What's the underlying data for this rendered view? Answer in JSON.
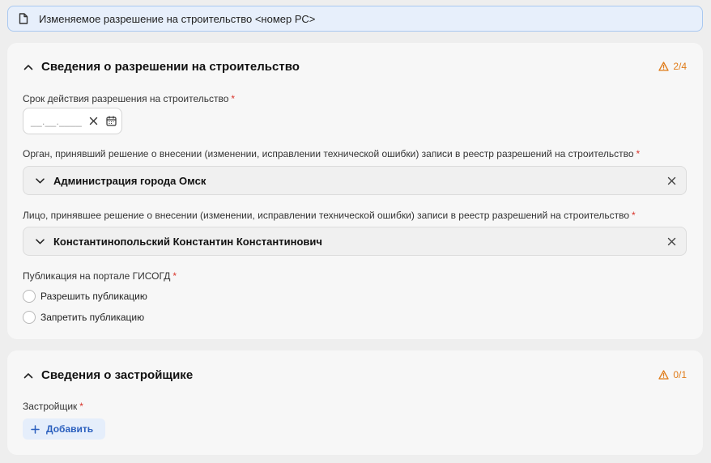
{
  "header": {
    "title": "Изменяемое разрешение на строительство <номер РС>",
    "icon": "document-icon"
  },
  "section1": {
    "title": "Сведения о разрешении на строительство",
    "progress": "2/4",
    "validity_label": "Срок действия разрешения на строительство",
    "date_mask": "__.__.____",
    "organ_label": "Орган, принявший решение о внесении (изменении, исправлении технической ошибки) записи в реестр разрешений на строительство",
    "organ_value": "Администрация города Омск",
    "person_label": "Лицо, принявшее решение о внесении (изменении, исправлении технической ошибки) записи в реестр разрешений на строительство",
    "person_value": "Константинопольский Константин Константинович",
    "publication_label": "Публикация на портале ГИСОГД",
    "publication_options": [
      "Разрешить публикацию",
      "Запретить публикацию"
    ]
  },
  "section2": {
    "title": "Сведения о застройщике",
    "progress": "0/1",
    "developer_label": "Застройщик",
    "add_label": "Добавить"
  },
  "required_mark": "*",
  "colors": {
    "accent": "#2a5fbe",
    "warning": "#e07c1a",
    "required": "#d9342b"
  }
}
